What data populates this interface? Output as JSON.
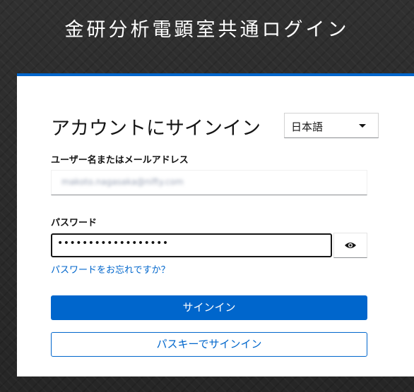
{
  "header": {
    "title": "金研分析電顕室共通ログイン"
  },
  "login": {
    "heading": "アカウントにサインイン",
    "language": {
      "selected": "日本語"
    },
    "username": {
      "label": "ユーザー名またはメールアドレス",
      "value": "makoto.nagasaka@nifty.com"
    },
    "password": {
      "label": "パスワード",
      "masked_value": "••••••••••••••••••"
    },
    "forgot_password": "パスワードをお忘れですか？",
    "signin_label": "サインイン",
    "passkey_label": "パスキーでサインイン"
  },
  "icons": {
    "password_toggle": "eye-icon",
    "language_dropdown": "caret-down-icon"
  },
  "colors": {
    "accent": "#0066cc",
    "text": "#151515",
    "background": "#2b2b2b"
  }
}
